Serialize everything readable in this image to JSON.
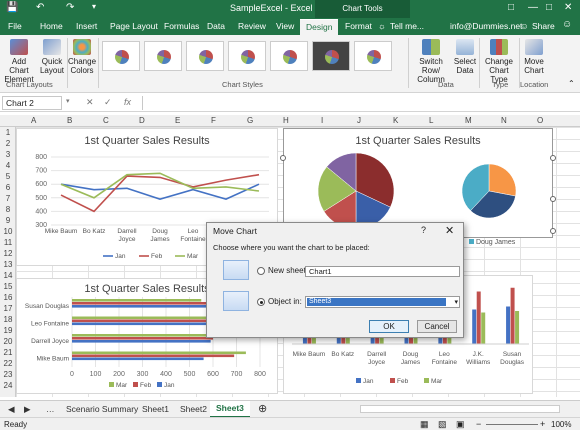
{
  "titlebar": {
    "title": "SampleExcel - Excel",
    "tools": "Chart Tools",
    "save_icon": "save-icon",
    "undo_icon": "undo-icon",
    "redo_icon": "redo-icon",
    "customize_icon": "customize-icon"
  },
  "menu": {
    "items": [
      "File",
      "Home",
      "Insert",
      "Page Layout",
      "Formulas",
      "Data",
      "Review",
      "View",
      "Design",
      "Format"
    ],
    "tell_me": "Tell me...",
    "account": "info@Dummies.net",
    "share": "Share"
  },
  "ribbon": {
    "add_chart_element": "Add Chart Element",
    "quick_layout": "Quick Layout",
    "change_colors": "Change Colors",
    "switch_row_column": "Switch Row/ Column",
    "select_data": "Select Data",
    "change_chart_type": "Change Chart Type",
    "move_chart": "Move Chart",
    "groups": {
      "layouts": "Chart Layouts",
      "styles": "Chart Styles",
      "data": "Data",
      "type": "Type",
      "location": "Location"
    }
  },
  "formula_bar": {
    "name_box": "Chart 2",
    "fx": "fx"
  },
  "columns": [
    "A",
    "B",
    "C",
    "D",
    "E",
    "F",
    "G",
    "H",
    "I",
    "J",
    "K",
    "L",
    "M",
    "N",
    "O"
  ],
  "rows": [
    "1",
    "2",
    "3",
    "4",
    "5",
    "6",
    "7",
    "8",
    "9",
    "10",
    "11",
    "12",
    "13",
    "14",
    "15",
    "16",
    "17",
    "18",
    "19",
    "20",
    "21",
    "22",
    "23",
    "24",
    "25"
  ],
  "dialog": {
    "title": "Move Chart",
    "help": "?",
    "close": "✕",
    "prompt": "Choose where you want the chart to be placed:",
    "new_sheet_label": "New sheet:",
    "new_sheet_value": "Chart1",
    "object_in_label": "Object in:",
    "object_in_value": "Sheet3",
    "ok": "OK",
    "cancel": "Cancel"
  },
  "sheet_tabs": [
    "Scenario Summary",
    "Sheet1",
    "Sheet2",
    "Sheet3"
  ],
  "status": {
    "ready": "Ready",
    "zoom": "100%"
  },
  "colors": {
    "excel_green": "#217346",
    "jan": "#4472c4",
    "feb": "#c0504d",
    "mar": "#9bbb59",
    "apr": "#8064a2",
    "may": "#f79646"
  },
  "chart_data": [
    {
      "type": "line",
      "title": "1st Quarter Sales Results",
      "categories": [
        "Mike Baum",
        "Bo Katz",
        "Darrell Joyce",
        "Doug James",
        "Leo Fontaine",
        "Brian Hunter",
        "Susan Douglas"
      ],
      "category_labels": [
        "Mike Baum",
        "Bo Katz",
        "Darrell\nJoyce",
        "Doug\nJames",
        "Leo\nFontaine",
        "Brian\nHunter",
        "Susan\nDouglas"
      ],
      "series": [
        {
          "name": "Jan",
          "values": [
            600,
            560,
            570,
            490,
            560,
            490,
            600
          ]
        },
        {
          "name": "Feb",
          "values": [
            520,
            400,
            660,
            650,
            580,
            630,
            670
          ]
        },
        {
          "name": "Mar",
          "values": [
            600,
            500,
            670,
            680,
            570,
            580,
            550
          ]
        }
      ],
      "yticks": [
        "800",
        "700",
        "600",
        "500",
        "400",
        "300"
      ],
      "ylim": [
        300,
        800
      ]
    },
    {
      "type": "bar",
      "title": "1st Quarter Sales Results",
      "categories": [
        "Mike Baum",
        "Darrell Joyce",
        "Leo Fontaine",
        "Susan Douglas"
      ],
      "series": [
        {
          "name": "Mar",
          "values": [
            740,
            620,
            680,
            550
          ]
        },
        {
          "name": "Feb",
          "values": [
            690,
            600,
            640,
            610
          ]
        },
        {
          "name": "Jan",
          "values": [
            560,
            590,
            620,
            580
          ]
        }
      ],
      "xticks": [
        "0",
        "100",
        "200",
        "300",
        "400",
        "500",
        "600",
        "700",
        "800"
      ],
      "xlim": [
        0,
        800
      ]
    },
    {
      "type": "pie",
      "title": "1st Quarter Sales Results",
      "legend_visible": [
        "Doug James"
      ],
      "slices_left": [
        {
          "value": 32,
          "color": "#8b2d2d"
        },
        {
          "value": 18,
          "color": "#3a5fa8"
        },
        {
          "value": 16,
          "color": "#c0504d"
        },
        {
          "value": 20,
          "color": "#9bbb59"
        },
        {
          "value": 14,
          "color": "#8064a2"
        }
      ],
      "slices_right": [
        {
          "value": 28,
          "color": "#f79646"
        },
        {
          "value": 34,
          "color": "#2e4f80"
        },
        {
          "value": 38,
          "color": "#4bacc6"
        }
      ]
    },
    {
      "type": "bar",
      "categories": [
        "Mike Baum",
        "Bo Katz",
        "Darrell Joyce",
        "Doug James",
        "Leo Fontaine",
        "J.K. Williams",
        "Susan Douglas"
      ],
      "category_labels": [
        "Mike Baum",
        "Bo Katz",
        "Darrell\nJoyce",
        "Doug\nJames",
        "Leo\nFontaine",
        "J.K.\nWilliams",
        "Susan\nDouglas"
      ],
      "series": [
        {
          "name": "Jan",
          "values": [
            45,
            40,
            50,
            48,
            42,
            46,
            50
          ]
        },
        {
          "name": "Feb",
          "values": [
            55,
            50,
            58,
            52,
            50,
            70,
            75
          ]
        },
        {
          "name": "Mar",
          "values": [
            30,
            35,
            38,
            40,
            36,
            42,
            44
          ]
        }
      ]
    }
  ]
}
